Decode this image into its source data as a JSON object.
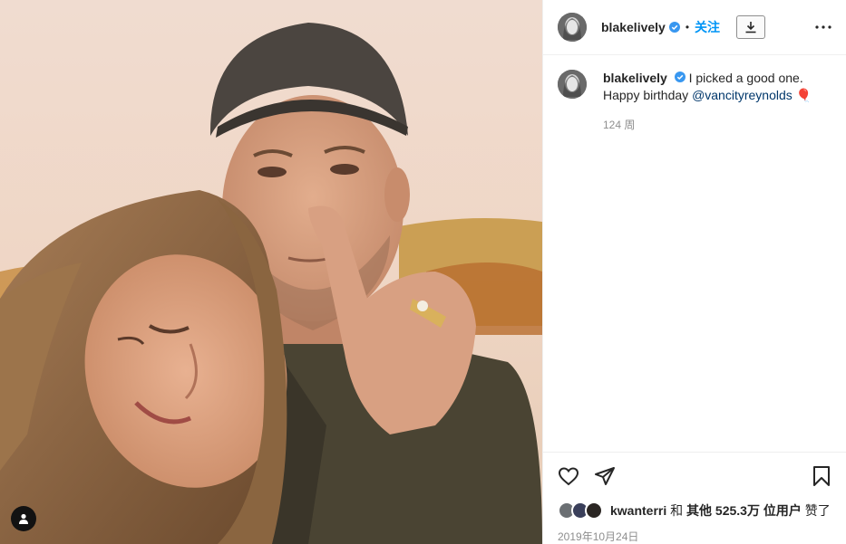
{
  "post": {
    "username": "blakelively",
    "follow_label": "关注",
    "separator": "•",
    "verified_icon": "verified-badge-icon",
    "download_icon": "download-icon",
    "more_icon": "more-options-icon"
  },
  "caption": {
    "username": "blakelively",
    "text_line1": "I picked a good one.",
    "text_line2_prefix": "Happy birthday ",
    "mention": "@vancityreynolds",
    "emoji": "🎈",
    "time_ago": "124 周"
  },
  "actions": {
    "like_icon": "heart-icon",
    "share_icon": "send-icon",
    "save_icon": "bookmark-icon"
  },
  "likes": {
    "liker": "kwanterri",
    "and": "和",
    "others_prefix": "其他",
    "count": "525.3万",
    "others_suffix": "位用户",
    "liked": "赞了"
  },
  "date": "2019年10月24日",
  "media": {
    "tag_icon": "user-tag-icon"
  },
  "colors": {
    "accent": "#0095f6",
    "verified": "#3897f0",
    "mention": "#00376b",
    "muted": "#8e8e8e"
  }
}
